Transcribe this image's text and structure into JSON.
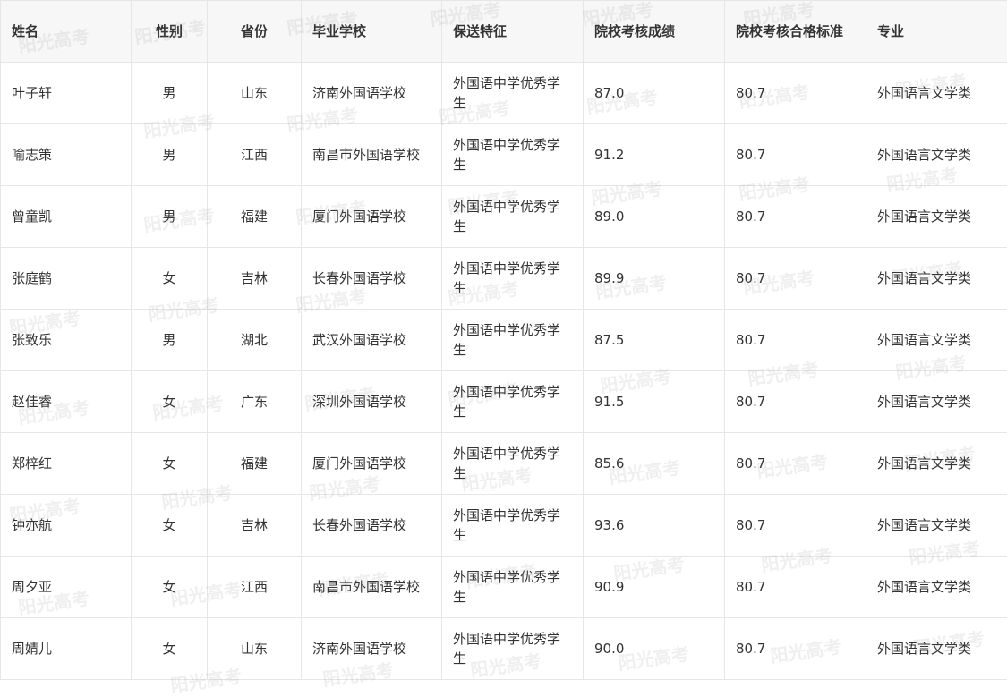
{
  "watermark": "阳光高考",
  "table": {
    "headers": [
      "姓名",
      "性别",
      "省份",
      "毕业学校",
      "保送特征",
      "院校考核成绩",
      "院校考核合格标准",
      "专业"
    ],
    "rows": [
      {
        "name": "叶子轩",
        "gender": "男",
        "province": "山东",
        "school": "济南外国语学校",
        "feature": "外国语中学优秀学生",
        "score": "87.0",
        "standard": "80.7",
        "major": "外国语言文学类"
      },
      {
        "name": "喻志策",
        "gender": "男",
        "province": "江西",
        "school": "南昌市外国语学校",
        "feature": "外国语中学优秀学生",
        "score": "91.2",
        "standard": "80.7",
        "major": "外国语言文学类"
      },
      {
        "name": "曾童凯",
        "gender": "男",
        "province": "福建",
        "school": "厦门外国语学校",
        "feature": "外国语中学优秀学生",
        "score": "89.0",
        "standard": "80.7",
        "major": "外国语言文学类"
      },
      {
        "name": "张庭鹤",
        "gender": "女",
        "province": "吉林",
        "school": "长春外国语学校",
        "feature": "外国语中学优秀学生",
        "score": "89.9",
        "standard": "80.7",
        "major": "外国语言文学类"
      },
      {
        "name": "张致乐",
        "gender": "男",
        "province": "湖北",
        "school": "武汉外国语学校",
        "feature": "外国语中学优秀学生",
        "score": "87.5",
        "standard": "80.7",
        "major": "外国语言文学类"
      },
      {
        "name": "赵佳睿",
        "gender": "女",
        "province": "广东",
        "school": "深圳外国语学校",
        "feature": "外国语中学优秀学生",
        "score": "91.5",
        "standard": "80.7",
        "major": "外国语言文学类"
      },
      {
        "name": "郑梓红",
        "gender": "女",
        "province": "福建",
        "school": "厦门外国语学校",
        "feature": "外国语中学优秀学生",
        "score": "85.6",
        "standard": "80.7",
        "major": "外国语言文学类"
      },
      {
        "name": "钟亦航",
        "gender": "女",
        "province": "吉林",
        "school": "长春外国语学校",
        "feature": "外国语中学优秀学生",
        "score": "93.6",
        "standard": "80.7",
        "major": "外国语言文学类"
      },
      {
        "name": "周夕亚",
        "gender": "女",
        "province": "江西",
        "school": "南昌市外国语学校",
        "feature": "外国语中学优秀学生",
        "score": "90.9",
        "standard": "80.7",
        "major": "外国语言文学类"
      },
      {
        "name": "周婧儿",
        "gender": "女",
        "province": "山东",
        "school": "济南外国语学校",
        "feature": "外国语中学优秀学生",
        "score": "90.0",
        "standard": "80.7",
        "major": "外国语言文学类"
      }
    ]
  }
}
